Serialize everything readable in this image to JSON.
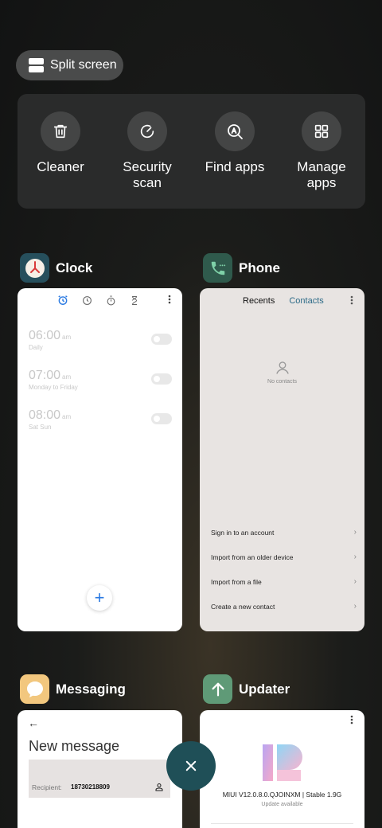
{
  "split_screen": {
    "label": "Split screen"
  },
  "tools": [
    {
      "label": "Cleaner",
      "icon": "trash-icon"
    },
    {
      "label": "Security\nscan",
      "icon": "security-scan-icon"
    },
    {
      "label": "Find apps",
      "icon": "find-apps-icon"
    },
    {
      "label": "Manage\napps",
      "icon": "grid-icon"
    }
  ],
  "apps": {
    "clock": {
      "name": "Clock",
      "icon_color": "#264f5c",
      "alarms": [
        {
          "time": "06:00",
          "ampm": "am",
          "label": "Daily"
        },
        {
          "time": "07:00",
          "ampm": "am",
          "label": "Monday to Friday"
        },
        {
          "time": "08:00",
          "ampm": "am",
          "label": "Sat Sun"
        }
      ],
      "fab": "+"
    },
    "phone": {
      "name": "Phone",
      "icon_color": "#2f5a4c",
      "tabs": [
        "Recents",
        "Contacts"
      ],
      "empty_text": "No contacts",
      "actions": [
        "Sign in to an account",
        "Import from an older device",
        "Import from a file",
        "Create a new contact"
      ]
    },
    "messaging": {
      "name": "Messaging",
      "icon_color": "#f2c77e",
      "title": "New message",
      "recipient_label": "Recipient:",
      "recipient_value": "18730218809"
    },
    "updater": {
      "name": "Updater",
      "icon_color": "#5f9a77",
      "version": "MIUI V12.0.8.0.QJOINXM | Stable 1.9G",
      "status": "Update available"
    }
  },
  "colors": {
    "accent": "#2a7ae2",
    "close_button": "#1f4f57"
  }
}
